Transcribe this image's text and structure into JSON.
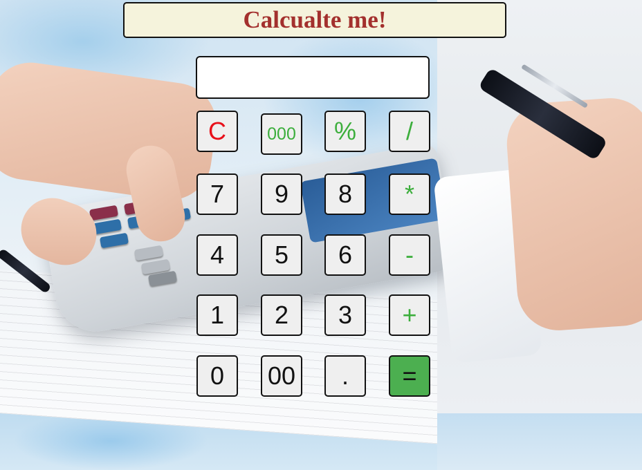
{
  "header": {
    "title": "Calcualte me!"
  },
  "display": {
    "value": ""
  },
  "keypad": {
    "rows": [
      [
        "C",
        "000",
        "%",
        "/"
      ],
      [
        "7",
        "9",
        "8",
        "*"
      ],
      [
        "4",
        "5",
        "6",
        "-"
      ],
      [
        "1",
        "2",
        "3",
        "+"
      ],
      [
        "0",
        "00",
        ".",
        "="
      ]
    ]
  },
  "colors": {
    "title_text": "#a3302d",
    "title_background": "#f5f3dc",
    "clear_key": "#e8101a",
    "operator_key": "#3cae3c",
    "equals_background": "#4caf50",
    "key_background": "#efefef"
  }
}
